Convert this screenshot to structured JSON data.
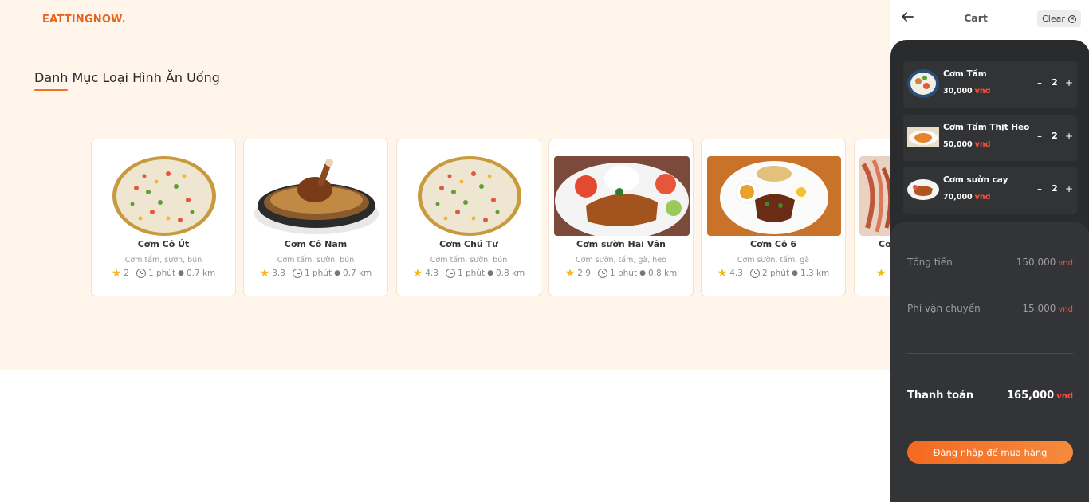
{
  "brand": {
    "logo": "EATTINGNOW."
  },
  "section": {
    "title": "Danh Mục Loại Hình Ăn Uống"
  },
  "restaurants": [
    {
      "name": "Cơm Cô Út",
      "desc": "Cơm tấm, sườn, bún",
      "rating": "2",
      "time": "1 phút",
      "distance": "0.7 km",
      "image": "fried-rice"
    },
    {
      "name": "Cơm Cô Năm",
      "desc": "Cơm tấm, sườn, bún",
      "rating": "3.3",
      "time": "1 phút",
      "distance": "0.7 km",
      "image": "chicken-biryani"
    },
    {
      "name": "Cơm Chú Tư",
      "desc": "Cơm tấm, sườn, bún",
      "rating": "4.3",
      "time": "1 phút",
      "distance": "0.8 km",
      "image": "fried-rice"
    },
    {
      "name": "Cơm sườn Hai Vân",
      "desc": "Cơm sườn, tấm, gà, heo",
      "rating": "2.9",
      "time": "1 phút",
      "distance": "0.8 km",
      "image": "pork-chop-plate"
    },
    {
      "name": "Cơm Cô 6",
      "desc": "Cơm sườn, tấm, gà",
      "rating": "4.3",
      "time": "2 phút",
      "distance": "1.3 km",
      "image": "broken-rice-plate"
    },
    {
      "name": "Cơ",
      "desc": "",
      "rating": "",
      "time": "",
      "distance": "",
      "image": "noodle-dish"
    }
  ],
  "cart": {
    "title": "Cart",
    "clear_label": "Clear",
    "currency": "vnd",
    "items": [
      {
        "name": "Cơm Tấm",
        "price": "30,000",
        "qty": "2"
      },
      {
        "name": "Cơm Tấm Thịt Heo",
        "price": "50,000",
        "qty": "2"
      },
      {
        "name": "Cơm sườn cay",
        "price": "70,000",
        "qty": "2"
      }
    ],
    "subtotal_label": "Tổng tiền",
    "subtotal": "150,000",
    "shipping_label": "Phí vận chuyển",
    "shipping": "15,000",
    "total_label": "Thanh toán",
    "total": "165,000",
    "login_button": "Đăng nhập để mua hàng"
  },
  "colors": {
    "accent": "#f07427",
    "hero_bg": "#fff5eb",
    "cart_bg": "#2a2b2d",
    "price_red": "#ff4d3d"
  }
}
